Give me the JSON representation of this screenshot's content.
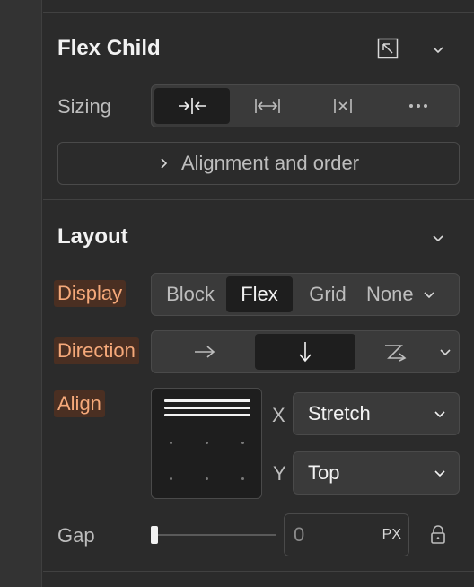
{
  "flex_child": {
    "title": "Flex Child",
    "sizing_label": "Sizing",
    "sizing_options": [
      {
        "icon": "shrink-icon",
        "active": true
      },
      {
        "icon": "grow-icon",
        "active": false
      },
      {
        "icon": "none-icon",
        "active": false
      },
      {
        "icon": "more-icon",
        "active": false
      }
    ],
    "alignment_button": "Alignment and order"
  },
  "layout": {
    "title": "Layout",
    "display_label": "Display",
    "display_options": [
      "Block",
      "Flex",
      "Grid",
      "None"
    ],
    "display_selected": "Flex",
    "direction_label": "Direction",
    "align_label": "Align",
    "x_label": "X",
    "x_value": "Stretch",
    "y_label": "Y",
    "y_value": "Top",
    "gap_label": "Gap",
    "gap_value": "0",
    "gap_unit": "PX"
  },
  "colors": {
    "highlight_bg": "#4a2f22",
    "highlight_text": "#f5a97a",
    "active_segment": "#1e1e1e"
  }
}
